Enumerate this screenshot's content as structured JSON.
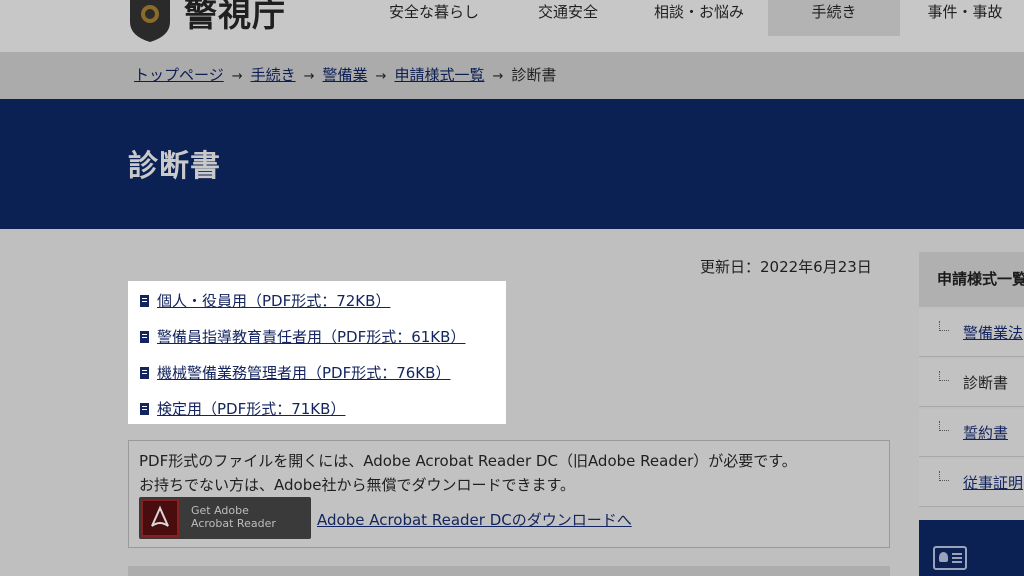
{
  "header": {
    "logo_text": "警視庁",
    "nav": [
      {
        "label": "安全な暮らし"
      },
      {
        "label": "交通安全"
      },
      {
        "label": "相談・お悩み"
      },
      {
        "label": "手続き",
        "active": true
      },
      {
        "label": "事件・事故"
      }
    ]
  },
  "breadcrumb": {
    "items": [
      "トップページ",
      "手続き",
      "警備業",
      "申請様式一覧"
    ],
    "separator": "→",
    "current": "診断書"
  },
  "page": {
    "title": "診断書",
    "updated": "更新日：2022年6月23日"
  },
  "files": [
    {
      "label": "個人・役員用（PDF形式：72KB）"
    },
    {
      "label": "警備員指導教育責任者用（PDF形式：61KB）"
    },
    {
      "label": "機械警備業務管理者用（PDF形式：76KB）"
    },
    {
      "label": "検定用（PDF形式：71KB）"
    }
  ],
  "pdf_notice": {
    "line1": "PDF形式のファイルを開くには、Adobe Acrobat Reader DC（旧Adobe Reader）が必要です。",
    "line2": "お持ちでない方は、Adobe社から無償でダウンロードできます。",
    "badge_line1": "Get Adobe",
    "badge_line2": "Acrobat Reader",
    "link": "Adobe Acrobat Reader DCのダウンロードへ"
  },
  "sidebar": {
    "heading": "申請様式一覧",
    "items": [
      {
        "label": "警備業法",
        "link": true
      },
      {
        "label": "診断書",
        "link": false
      },
      {
        "label": "誓約書",
        "link": true
      },
      {
        "label": "従事証明",
        "link": true
      }
    ]
  },
  "colors": {
    "title_band": "#0b2154",
    "link": "#13245e",
    "breadcrumb_bg": "#ababab"
  }
}
